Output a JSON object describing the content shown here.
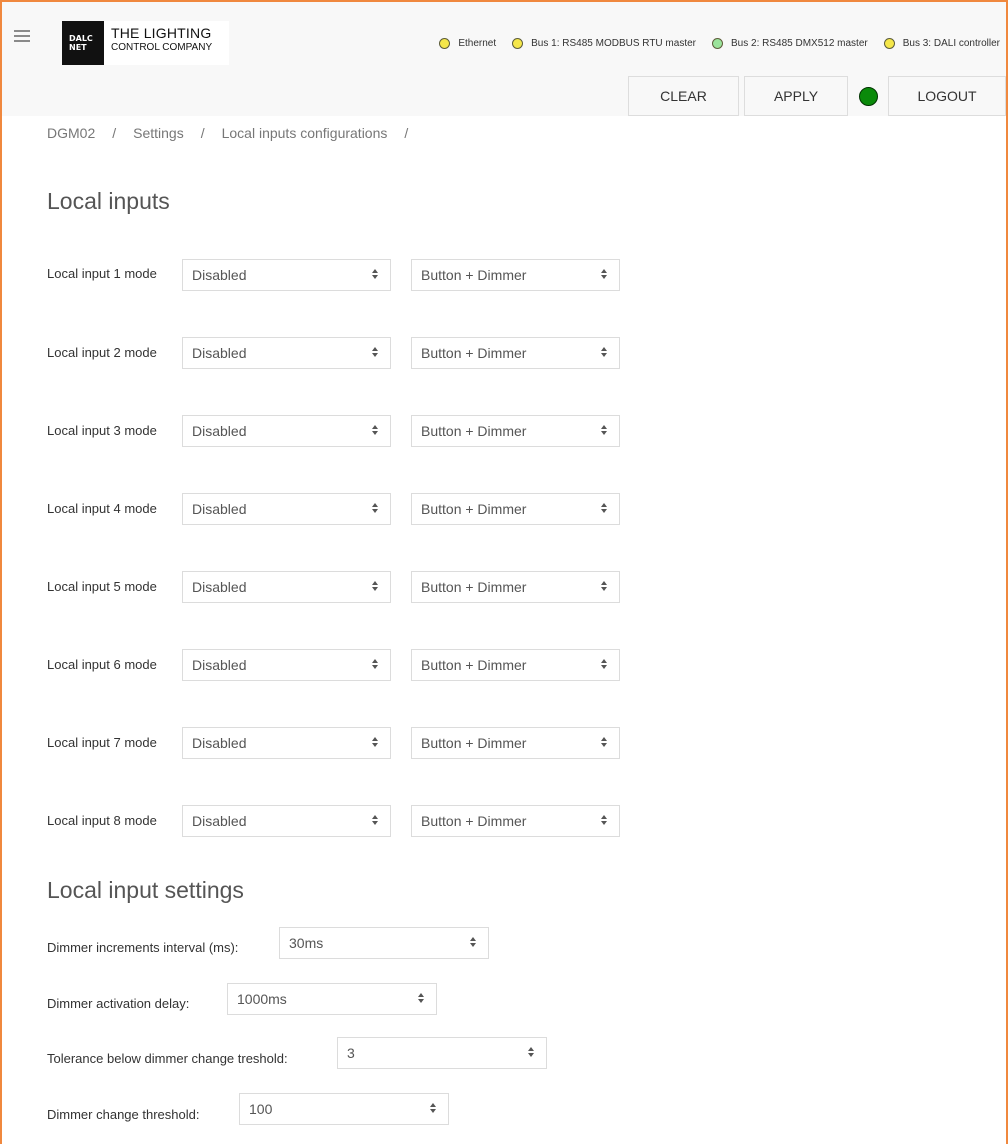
{
  "header": {
    "logo_mark_line1": "DALC",
    "logo_mark_line2": "NET",
    "logo_line1": "THE LIGHTING",
    "logo_line2": "CONTROL COMPANY",
    "status": [
      {
        "label": "Ethernet",
        "color": "#f5e74a"
      },
      {
        "label": "Bus 1: RS485 MODBUS RTU master",
        "color": "#f5e74a"
      },
      {
        "label": "Bus 2: RS485 DMX512 master",
        "color": "#9be39b"
      },
      {
        "label": "Bus 3: DALI controller",
        "color": "#f5e74a"
      }
    ]
  },
  "actions": {
    "clear": "CLEAR",
    "apply": "APPLY",
    "logout": "LOGOUT",
    "connection_color": "#0a8a0a"
  },
  "breadcrumb": [
    "DGM02",
    "Settings",
    "Local inputs configurations"
  ],
  "breadcrumb_sep": "/",
  "local_inputs": {
    "title": "Local inputs",
    "rows": [
      {
        "label": "Local input 1 mode",
        "mode": "Disabled",
        "function": "Button + Dimmer"
      },
      {
        "label": "Local input 2 mode",
        "mode": "Disabled",
        "function": "Button + Dimmer"
      },
      {
        "label": "Local input 3 mode",
        "mode": "Disabled",
        "function": "Button + Dimmer"
      },
      {
        "label": "Local input 4 mode",
        "mode": "Disabled",
        "function": "Button + Dimmer"
      },
      {
        "label": "Local input 5 mode",
        "mode": "Disabled",
        "function": "Button + Dimmer"
      },
      {
        "label": "Local input 6 mode",
        "mode": "Disabled",
        "function": "Button + Dimmer"
      },
      {
        "label": "Local input 7 mode",
        "mode": "Disabled",
        "function": "Button + Dimmer"
      },
      {
        "label": "Local input 8 mode",
        "mode": "Disabled",
        "function": "Button + Dimmer"
      }
    ]
  },
  "settings": {
    "title": "Local input settings",
    "dimmer_interval": {
      "label": "Dimmer increments interval (ms):",
      "value": "30ms"
    },
    "activation_delay": {
      "label": "Dimmer activation delay:",
      "value": "1000ms"
    },
    "tolerance": {
      "label": "Tolerance below dimmer change treshold:",
      "value": "3"
    },
    "change_threshold": {
      "label": "Dimmer change threshold:",
      "value": "100"
    }
  }
}
